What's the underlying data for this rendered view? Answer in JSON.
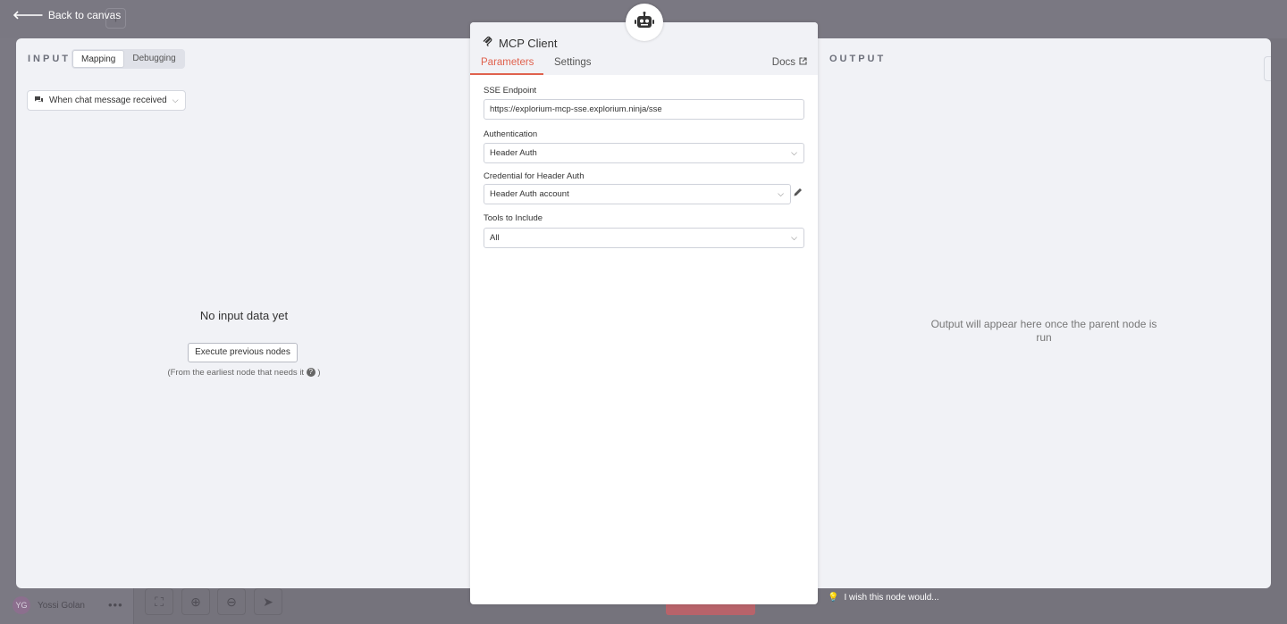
{
  "background": {
    "username": "Yossi Golan",
    "avatar_initials": "YG",
    "more_icon": "more-dots-icon",
    "wish_text": "I wish this node would...",
    "add_icon": "plus-icon"
  },
  "header": {
    "back_label": "Back to canvas"
  },
  "input_pane": {
    "label": "INPUT",
    "toggle": [
      "Mapping",
      "Debugging"
    ],
    "active_toggle": "Mapping",
    "trigger_select": "When chat message received",
    "empty_title": "No input data yet",
    "execute_button": "Execute previous nodes",
    "hint_prefix": "(From the earliest node that needs it",
    "hint_suffix": ")"
  },
  "output_pane": {
    "label": "OUTPUT",
    "message": "Output will appear here once the parent node is run"
  },
  "node": {
    "title": "MCP Client",
    "icon": "robot-icon",
    "tabs": [
      "Parameters",
      "Settings"
    ],
    "active_tab": "Parameters",
    "docs_label": "Docs",
    "fields": {
      "sse_label": "SSE Endpoint",
      "sse_value": "https://explorium-mcp-sse.explorium.ninja/sse",
      "auth_label": "Authentication",
      "auth_value": "Header Auth",
      "cred_label": "Credential for Header Auth",
      "cred_value": "Header Auth account",
      "tools_label": "Tools to Include",
      "tools_value": "All"
    }
  },
  "colors": {
    "accent": "#e0624e",
    "panel_bg": "#f1f2f6",
    "overlay": "#75737c"
  }
}
